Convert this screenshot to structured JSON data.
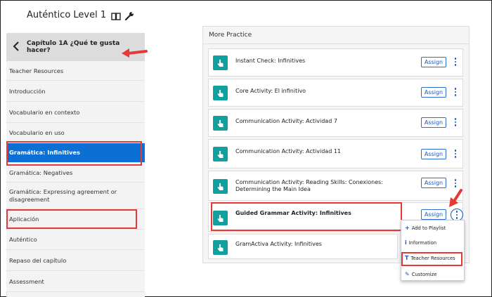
{
  "sidebar": {
    "course_title": "Auténtico Level 1",
    "chapter_title": "Capítulo 1A ¿Qué te gusta hacer?",
    "items": [
      {
        "label": "Teacher Resources"
      },
      {
        "label": "Introducción"
      },
      {
        "label": "Vocabulario en contexto"
      },
      {
        "label": "Vocabulario en uso"
      },
      {
        "label": "Gramática: Infinitives"
      },
      {
        "label": "Gramática: Negatives"
      },
      {
        "label": "Gramática: Expressing agreement or disagreement"
      },
      {
        "label": "Aplicación"
      },
      {
        "label": "Auténtico"
      },
      {
        "label": "Repaso del capítulo"
      },
      {
        "label": "Assessment"
      }
    ]
  },
  "panel": {
    "title": "More Practice",
    "assign_label": "Assign",
    "activities": [
      {
        "label": "Instant Check: Infinitives"
      },
      {
        "label": "Core Activity: El infinitivo"
      },
      {
        "label": "Communication Activity: Actividad 7"
      },
      {
        "label": "Communication Activity: Actividad 11"
      },
      {
        "label": "Communication Activity: Reading Skills: Conexiones: Determining the Main Idea"
      },
      {
        "label": "Guided Grammar Activity: Infinitives"
      },
      {
        "label": "GramActiva Activity: Infinitives"
      }
    ]
  },
  "menu": {
    "items": [
      {
        "icon": "plus-icon",
        "glyph": "+",
        "label": "Add to Playlist"
      },
      {
        "icon": "info-icon",
        "glyph": "i",
        "label": "Information"
      },
      {
        "icon": "teacher-resources-icon",
        "glyph": "T",
        "label": "Teacher Resources"
      },
      {
        "icon": "edit-icon",
        "glyph": "✎",
        "label": "Customize"
      }
    ]
  },
  "colors": {
    "accent": "#0b6fd4",
    "activity_icon": "#10a0a0",
    "highlight": "#e53935",
    "link": "#1a57b8"
  }
}
